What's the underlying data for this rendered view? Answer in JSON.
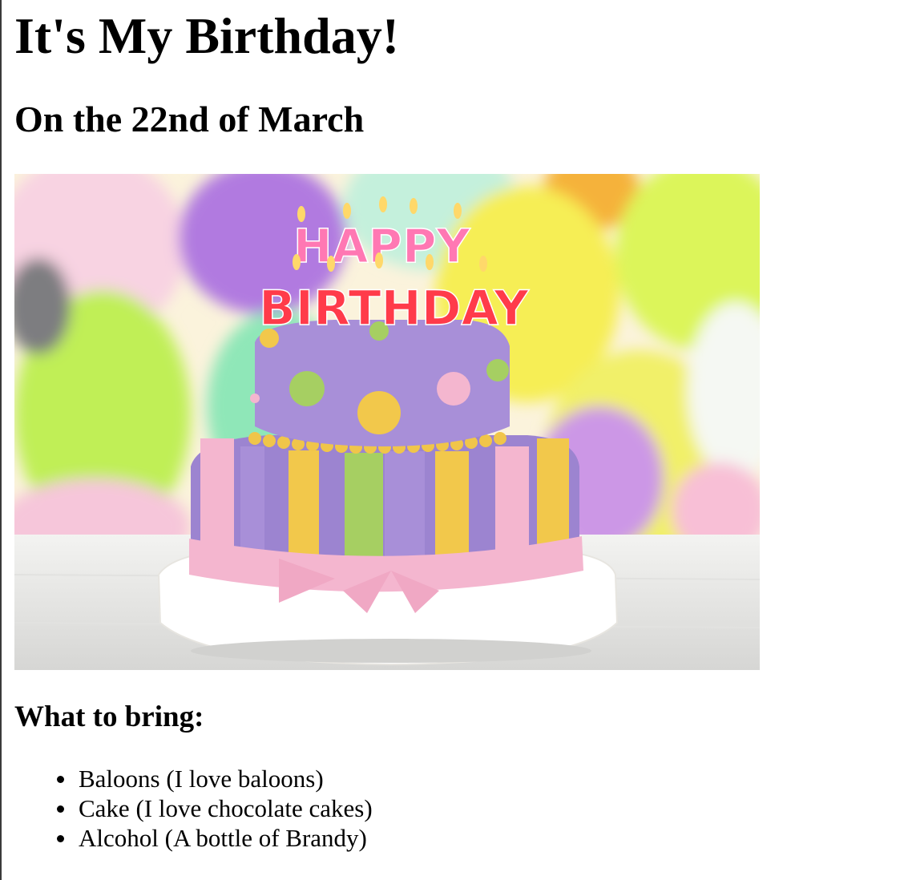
{
  "page": {
    "title": "It's My Birthday!",
    "subtitle": "On the 22nd of March"
  },
  "image": {
    "cake_topper_line1": "HAPPY",
    "cake_topper_line2": "BIRTHDAY"
  },
  "bring_section": {
    "heading": "What to bring:",
    "items": [
      "Baloons (I love baloons)",
      "Cake (I love chocolate cakes)",
      "Alcohol (A bottle of Brandy)"
    ]
  },
  "colors": {
    "text": "#000000",
    "background": "#ffffff",
    "cake_top": "#a88fd8",
    "cake_bottom": "#9c84d0",
    "ribbon": "#f4b6cf",
    "stripe_yellow": "#f2c84b",
    "stripe_green": "#a6cf62"
  }
}
